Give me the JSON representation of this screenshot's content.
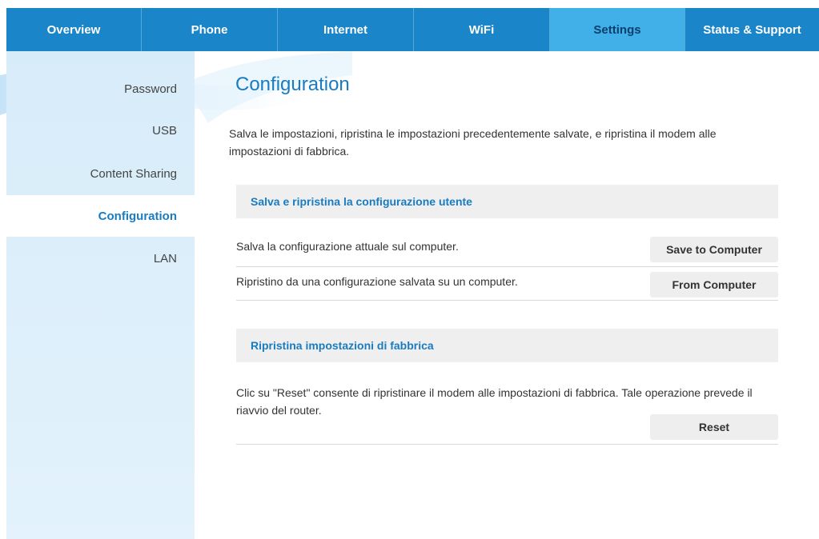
{
  "nav": {
    "tabs": [
      {
        "label": "Overview",
        "active": false
      },
      {
        "label": "Phone",
        "active": false
      },
      {
        "label": "Internet",
        "active": false
      },
      {
        "label": "WiFi",
        "active": false
      },
      {
        "label": "Settings",
        "active": true
      },
      {
        "label": "Status & Support",
        "active": false
      }
    ]
  },
  "sidebar": {
    "items": [
      {
        "label": "Password",
        "active": false
      },
      {
        "label": "USB",
        "active": false
      },
      {
        "label": "Content Sharing",
        "active": false
      },
      {
        "label": "Configuration",
        "active": true
      },
      {
        "label": "LAN",
        "active": false
      }
    ]
  },
  "main": {
    "title": "Configuration",
    "intro": "Salva le impostazioni, ripristina le impostazioni precedentemente salvate, e ripristina il modem alle impostazioni di fabbrica.",
    "backup_section": {
      "heading": "Salva e ripristina la configurazione utente",
      "save_text": "Salva la configurazione attuale sul computer.",
      "save_button": "Save to Computer",
      "restore_text": "Ripristino da una configurazione salvata su un computer.",
      "restore_button": "From Computer"
    },
    "factory_section": {
      "heading": "Ripristina impostazioni di fabbrica",
      "text": "Clic su \"Reset\" consente di ripristinare il modem alle impostazioni di fabbrica. Tale operazione prevede il riavvio del router.",
      "reset_button": "Reset"
    }
  },
  "colors": {
    "nav_bg": "#1a85c8",
    "nav_active_bg": "#42b0e8",
    "accent": "#1a7cc0",
    "sidebar_bg": "#dceefa"
  }
}
